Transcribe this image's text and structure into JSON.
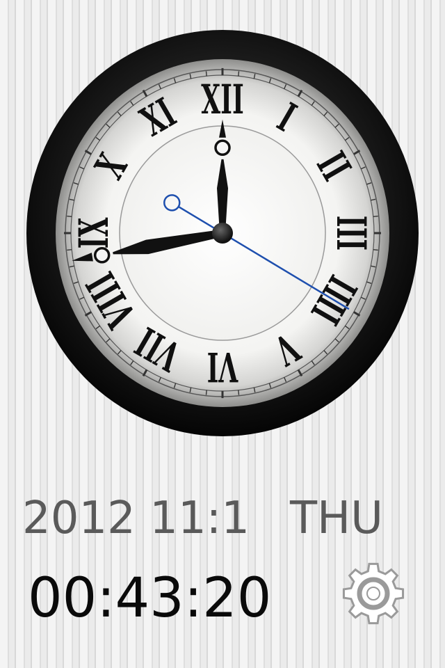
{
  "date": "2012 11:1",
  "weekday": "THU",
  "time": "00:43:20",
  "clock": {
    "numerals": [
      "XII",
      "I",
      "II",
      "III",
      "IIII",
      "V",
      "VI",
      "VII",
      "VIII",
      "IX",
      "X",
      "XI"
    ],
    "hour_hand_hour": 12,
    "minute_hand_minute": 43,
    "second_hand_second": 20,
    "second_hand_color": "#1e4fae"
  },
  "icons": {
    "settings": "gear-icon"
  }
}
